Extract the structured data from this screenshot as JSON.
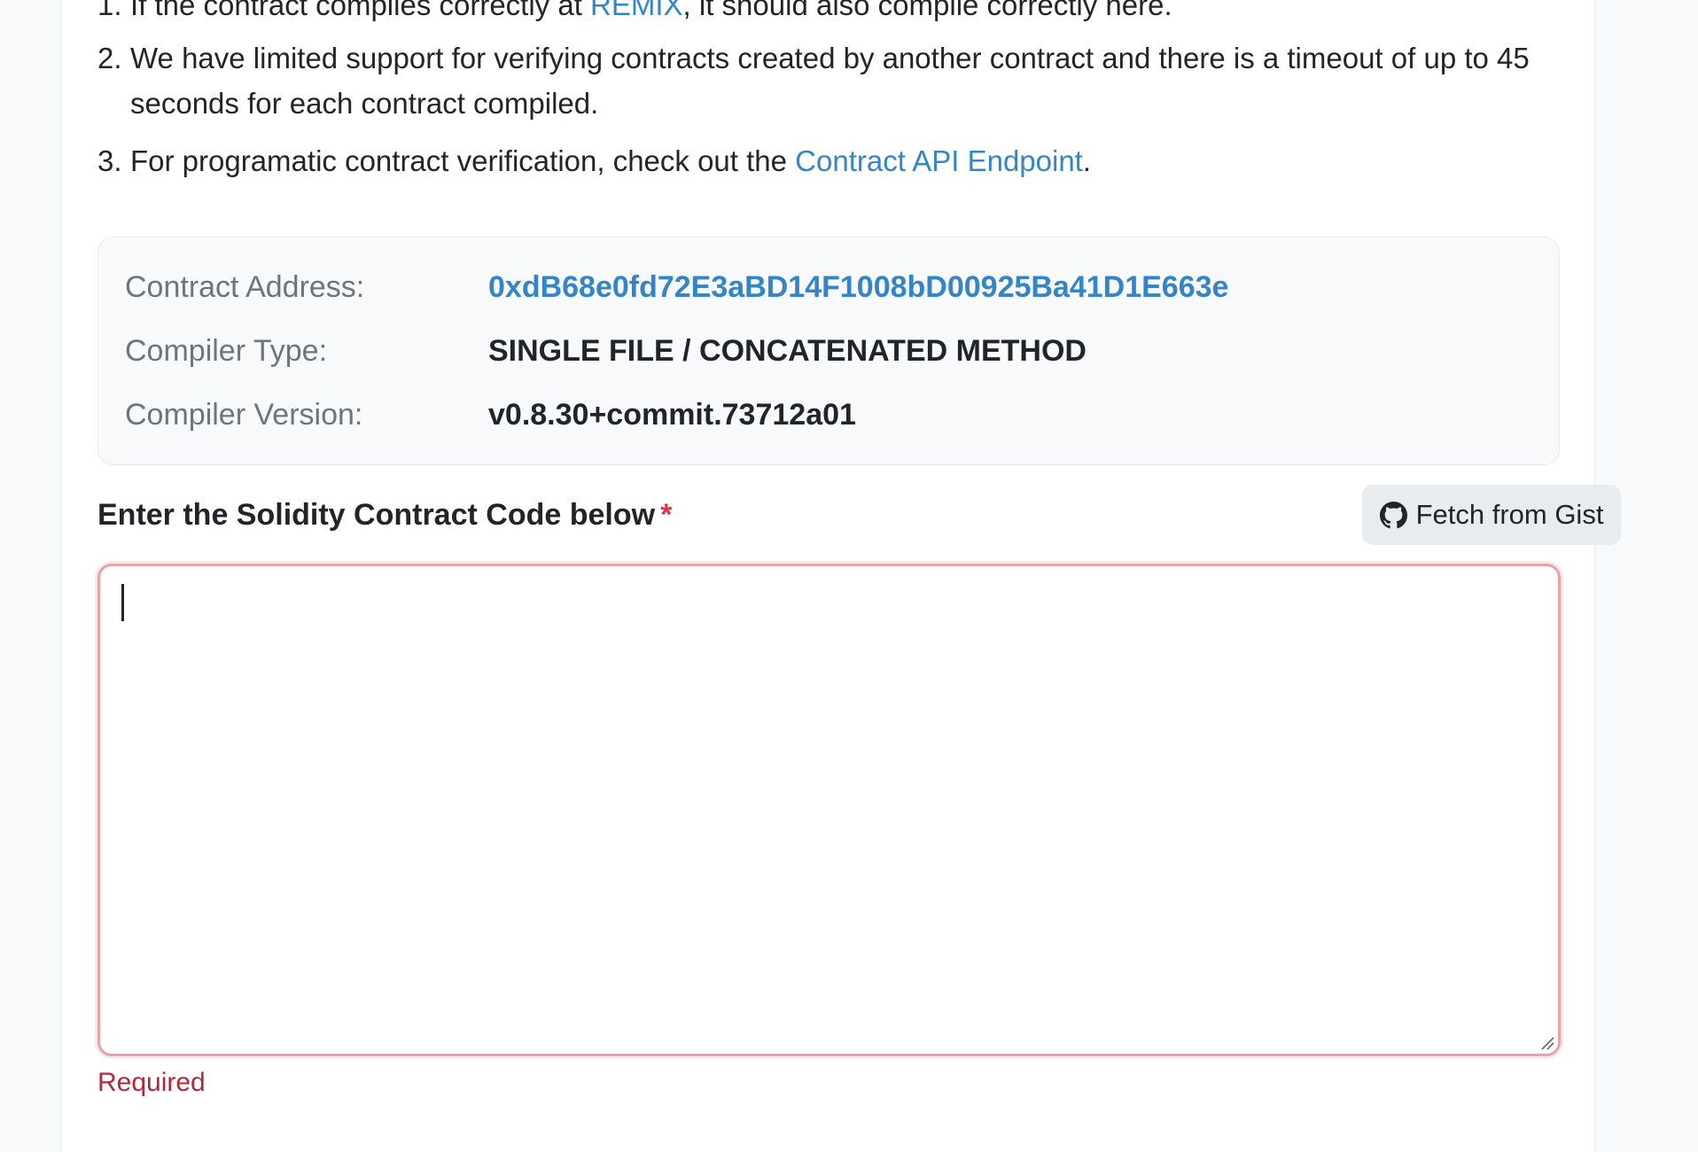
{
  "notes": [
    {
      "num": "1.",
      "before": "If the contract compiles correctly at ",
      "link": "REMIX",
      "after": ", it should also compile correctly here."
    },
    {
      "num": "2.",
      "text": "We have limited support for verifying contracts created by another contract and there is a timeout of up to 45 seconds for each contract compiled."
    },
    {
      "num": "3.",
      "before": "For programatic contract verification, check out the ",
      "link": "Contract API Endpoint",
      "after": "."
    }
  ],
  "info": {
    "address_label": "Contract Address:",
    "address_value": "0xdB68e0fd72E3aBD14F1008bD00925Ba41D1E663e",
    "compiler_type_label": "Compiler Type:",
    "compiler_type_value": "SINGLE FILE / CONCATENATED METHOD",
    "compiler_version_label": "Compiler Version:",
    "compiler_version_value": "v0.8.30+commit.73712a01"
  },
  "code_section": {
    "label": "Enter the Solidity Contract Code below",
    "required_mark": "*",
    "fetch_button": "Fetch from Gist",
    "fetch_icon": "github-icon",
    "textarea_value": "",
    "error_text": "Required"
  },
  "colors": {
    "link": "#3485c8",
    "required": "#dc3545",
    "error_text": "#b02a37",
    "error_border": "#eaa1a8"
  }
}
